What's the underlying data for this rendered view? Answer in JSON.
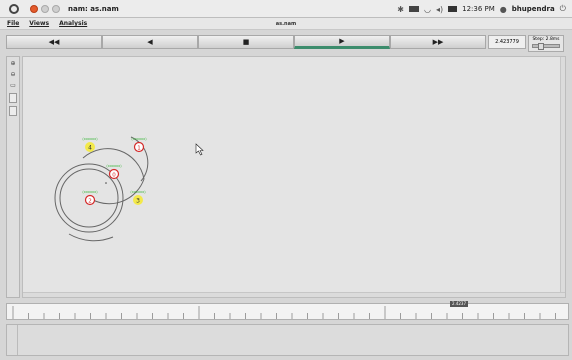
{
  "os": {
    "window_title": "nam: as.nam",
    "tray_time": "12:36 PM",
    "tray_user": "bhupendra"
  },
  "menubar": {
    "file": "File",
    "views": "Views",
    "analysis": "Analysis",
    "file_title": "as.nam"
  },
  "controls": {
    "rewind": "◀◀",
    "back": "◀",
    "stop": "■",
    "play": "▶",
    "fast_forward": "▶▶",
    "time_value": "2.423779",
    "step_label": "Step: 2.8ms"
  },
  "nodes": [
    {
      "id": "4",
      "label": "4",
      "tag": "(xxxxxx)",
      "color": "yellow"
    },
    {
      "id": "1",
      "label": "1",
      "tag": "(xxxxxx)",
      "color": "red"
    },
    {
      "id": "0",
      "label": "0",
      "tag": "(xxxxxx)",
      "color": "red"
    },
    {
      "id": "2",
      "label": "2",
      "tag": "(xxxxxx)",
      "color": "red"
    },
    {
      "id": "3",
      "label": "3",
      "tag": "(xxxxxx)",
      "color": "yellow"
    }
  ],
  "timeline": {
    "marker": "2.4237"
  },
  "colors": {
    "active_accent": "#3c8c6c",
    "node_red": "#d52a2a",
    "node_yellow": "#f3e94a",
    "label_green": "#34b534"
  }
}
